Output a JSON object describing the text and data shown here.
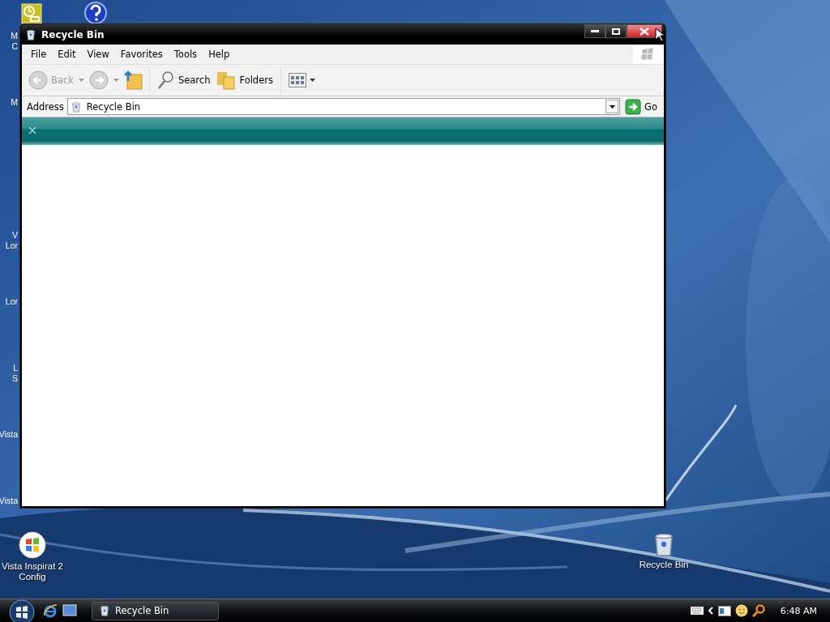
{
  "desktop": {
    "left_labels": [
      {
        "lines": [
          "M",
          "C"
        ]
      },
      {
        "lines": [
          "M"
        ]
      },
      {
        "lines": [
          "V",
          "Lor"
        ]
      },
      {
        "lines": [
          "Lor"
        ]
      },
      {
        "lines": [
          "L",
          "S"
        ]
      },
      {
        "lines": [
          "Vista"
        ]
      },
      {
        "lines": [
          "Vista"
        ]
      }
    ],
    "shortcut": {
      "lines": [
        "Vista Inspirat 2",
        "Config"
      ]
    },
    "recycle_bin": {
      "label": "Recycle Bin"
    }
  },
  "window": {
    "title": "Recycle Bin",
    "active": true,
    "menu": [
      "File",
      "Edit",
      "View",
      "Favorites",
      "Tools",
      "Help"
    ],
    "toolbar": {
      "back": {
        "label": "Back",
        "disabled": true
      },
      "forward": {
        "disabled": true
      },
      "search": "Search",
      "folders": "Folders"
    },
    "address": {
      "label": "Address",
      "value": "Recycle Bin",
      "go": "Go"
    }
  },
  "taskbar": {
    "tasks": [
      {
        "label": "Recycle Bin",
        "selected": false
      }
    ],
    "clock": "6:48 AM"
  }
}
